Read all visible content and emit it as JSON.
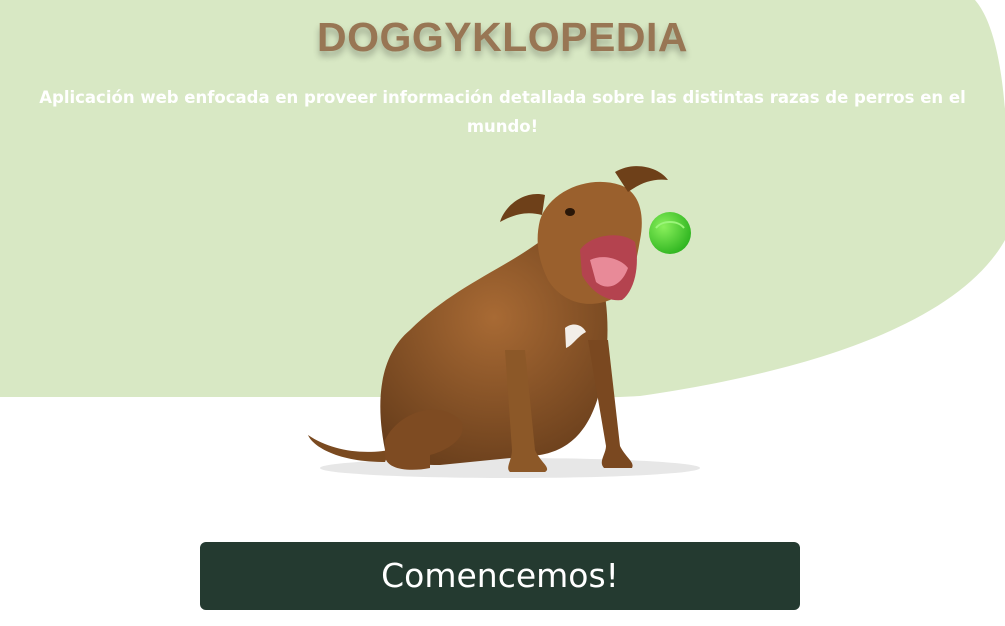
{
  "header": {
    "title": "DOGGYKLOPEDIA",
    "subtitle": "Aplicación web enfocada en proveer información detallada sobre las distintas razas de perros en el mundo!"
  },
  "hero": {
    "image": "dog-catching-ball-illustration"
  },
  "cta": {
    "label": "Comencemos!"
  },
  "colors": {
    "background_shape": "#d8e8c4",
    "title": "#987654",
    "button": "#243a30",
    "ball": "#4fd635",
    "dog": "#8a5527"
  }
}
